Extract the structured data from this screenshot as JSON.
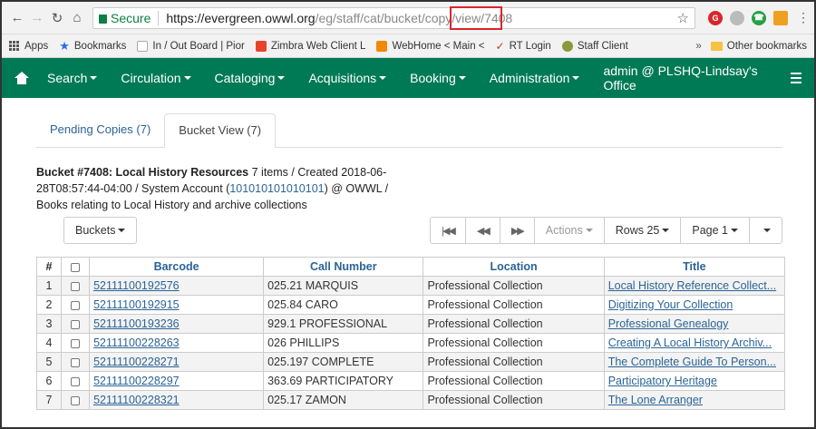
{
  "browser": {
    "secure_label": "Secure",
    "url_host": "https://evergreen.owwl.org",
    "url_path": "/eg/staff/cat/bucket/copy/view/7408"
  },
  "bookmarks": {
    "items": [
      "Apps",
      "Bookmarks",
      "In / Out Board | Pior",
      "Zimbra Web Client L",
      "WebHome < Main <",
      "RT Login",
      "Staff Client"
    ],
    "more": "»",
    "other": "Other bookmarks"
  },
  "nav": {
    "items": [
      "Search",
      "Circulation",
      "Cataloging",
      "Acquisitions",
      "Booking",
      "Administration"
    ],
    "user": "admin @ PLSHQ-Lindsay's Office"
  },
  "tabs": [
    "Pending Copies (7)",
    "Bucket View (7)"
  ],
  "bucket": {
    "name": "Bucket #7408: Local History Resources",
    "meta_1": " 7 items / Created 2018-06-28T08:57:44-04:00 / System Account (",
    "account_link": "101010101010101",
    "meta_2": ") @ OWWL / Books relating to Local History and archive collections"
  },
  "controls": {
    "buckets": "Buckets",
    "actions": "Actions",
    "rows": "Rows 25",
    "page": "Page 1"
  },
  "table": {
    "headers": [
      "#",
      "Barcode",
      "Call Number",
      "Location",
      "Title"
    ],
    "rows": [
      {
        "n": "1",
        "barcode": "52111100192576",
        "call": "025.21 MARQUIS",
        "loc": "Professional Collection",
        "title": "Local History Reference Collect..."
      },
      {
        "n": "2",
        "barcode": "52111100192915",
        "call": "025.84 CARO",
        "loc": "Professional Collection",
        "title": "Digitizing Your Collection"
      },
      {
        "n": "3",
        "barcode": "52111100193236",
        "call": "929.1 PROFESSIONAL",
        "loc": "Professional Collection",
        "title": "Professional Genealogy"
      },
      {
        "n": "4",
        "barcode": "52111100228263",
        "call": "026 PHILLIPS",
        "loc": "Professional Collection",
        "title": "Creating A Local History Archiv..."
      },
      {
        "n": "5",
        "barcode": "52111100228271",
        "call": "025.197 COMPLETE",
        "loc": "Professional Collection",
        "title": "The Complete Guide To Person..."
      },
      {
        "n": "6",
        "barcode": "52111100228297",
        "call": "363.69 PARTICIPATORY",
        "loc": "Professional Collection",
        "title": "Participatory Heritage"
      },
      {
        "n": "7",
        "barcode": "52111100228321",
        "call": "025.17 ZAMON",
        "loc": "Professional Collection",
        "title": "The Lone Arranger"
      }
    ]
  }
}
